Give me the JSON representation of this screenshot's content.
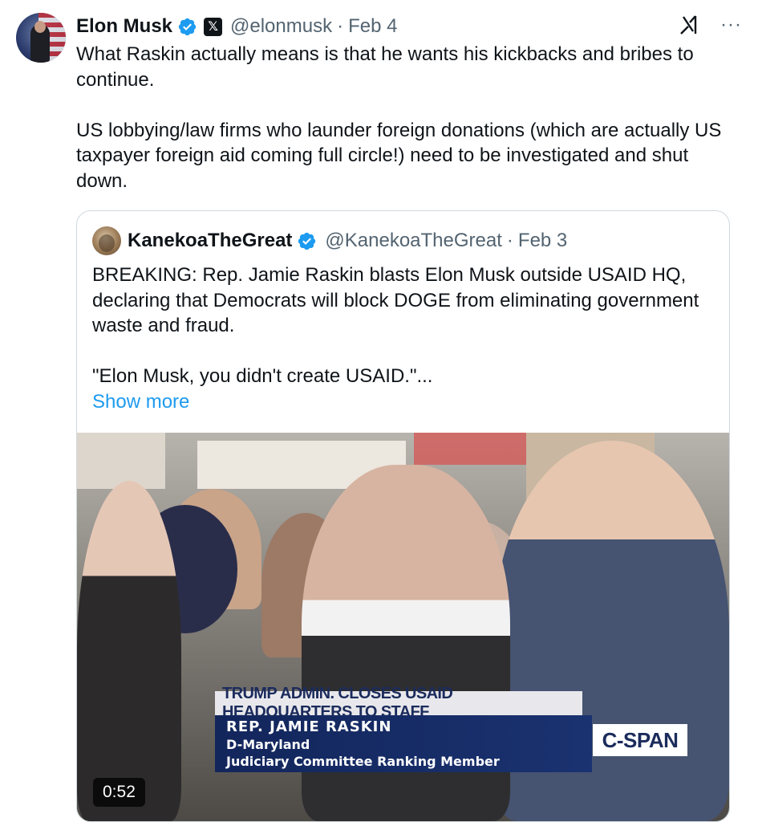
{
  "tweet": {
    "author_name": "Elon Musk",
    "author_handle": "@elonmusk",
    "separator": "·",
    "date": "Feb 4",
    "paragraphs": [
      "What Raskin actually means is that he wants his kickbacks and bribes to continue.",
      "US lobbying/law firms who launder foreign donations (which are actually US taxpayer foreign aid coming full circle!) need to be investigated and shut down."
    ],
    "icons": {
      "verified": "verified-badge-icon",
      "affiliate": "x-affiliate-icon",
      "grok": "grok-icon",
      "more": "more-icon"
    },
    "more_glyph": "···"
  },
  "quote": {
    "author_name": "KanekoaTheGreat",
    "author_handle": "@KanekoaTheGreat",
    "separator": "·",
    "date": "Feb 3",
    "paragraphs": [
      "BREAKING: Rep. Jamie Raskin blasts Elon Musk outside USAID HQ, declaring that Democrats will block DOGE from eliminating government waste and fraud.",
      "\"Elon Musk, you didn't create USAID.\"..."
    ],
    "show_more": "Show more"
  },
  "video": {
    "chyron_top": "TRUMP ADMIN. CLOSES USAID HEADQUARTERS TO STAFF",
    "chyron_name": "REP. JAMIE RASKIN",
    "chyron_line1": "D-Maryland",
    "chyron_line2": "Judiciary Committee Ranking Member",
    "network": "C-SPAN",
    "duration": "0:52"
  },
  "colors": {
    "text": "#0f1419",
    "muted": "#536471",
    "link": "#1d9bf0",
    "verified": "#1d9bf0",
    "border": "#cfd9de"
  }
}
